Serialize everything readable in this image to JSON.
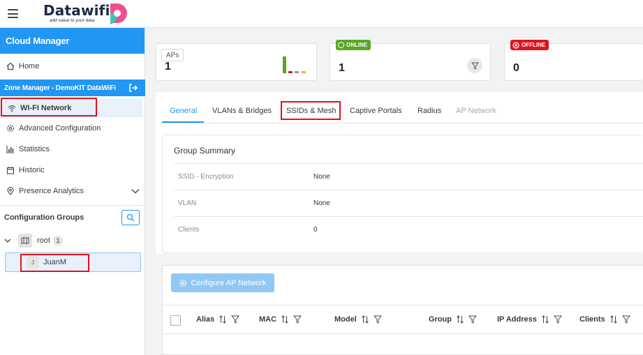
{
  "app": {
    "logo_text": "Datawifi",
    "logo_tagline": "add value to your data"
  },
  "sidebar": {
    "title": "Cloud Manager",
    "home_label": "Home",
    "zone_label": "Zone Manager - DemoKIT DataWiFi",
    "items": [
      {
        "label": "WI-FI Network",
        "icon": "wifi-icon"
      },
      {
        "label": "Advanced Configuration",
        "icon": "gear-icon"
      },
      {
        "label": "Statistics",
        "icon": "bar-chart-icon"
      },
      {
        "label": "Historic",
        "icon": "calendar-icon"
      },
      {
        "label": "Presence Analytics",
        "icon": "location-pin-icon"
      }
    ],
    "config_groups_label": "Configuration Groups",
    "tree": {
      "root_label": "root",
      "root_count": "1",
      "child_avatar": "J",
      "child_label": "JuanM"
    }
  },
  "stats": {
    "aps_label": "APs",
    "aps_count": "1",
    "online_label": "ONLINE",
    "online_count": "1",
    "offline_label": "OFFLINE",
    "offline_count": "0"
  },
  "tabs": [
    "General",
    "VLANs & Bridges",
    "SSIDs & Mesh",
    "Captive Portals",
    "Radius",
    "AP Network"
  ],
  "summary": {
    "title": "Group Summary",
    "rows": [
      {
        "key": "SSID - Encryption",
        "value": "None"
      },
      {
        "key": "VLAN",
        "value": "None"
      },
      {
        "key": "Clients",
        "value": "0"
      }
    ]
  },
  "table": {
    "configure_button": "Configure AP Network",
    "columns": [
      "Alias",
      "MAC",
      "Model",
      "Group",
      "IP Address",
      "Clients"
    ]
  },
  "colors": {
    "accent": "#2196f3",
    "online": "#5aa625",
    "offline": "#e0121c",
    "highlight": "#e0121c"
  }
}
